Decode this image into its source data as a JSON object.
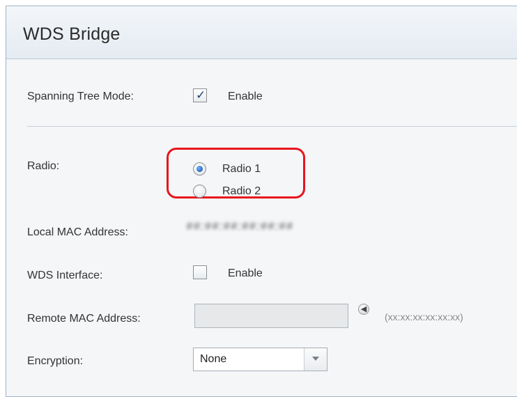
{
  "page_title": "WDS Bridge",
  "spanning_tree": {
    "label": "Spanning Tree Mode:",
    "option_label": "Enable",
    "checked": true
  },
  "radio": {
    "label": "Radio:",
    "options": [
      {
        "label": "Radio 1",
        "selected": true
      },
      {
        "label": "Radio 2",
        "selected": false
      }
    ],
    "highlight_color": "#e8141c"
  },
  "local_mac": {
    "label": "Local MAC Address:",
    "value": "##:##:##:##:##:##"
  },
  "wds_interface": {
    "label": "WDS Interface:",
    "option_label": "Enable",
    "checked": false
  },
  "remote_mac": {
    "label": "Remote MAC Address:",
    "value": "",
    "hint": "(xx:xx:xx:xx:xx:xx)",
    "go_icon": "arrow-left-icon"
  },
  "encryption": {
    "label": "Encryption:",
    "selected": "None"
  },
  "colors": {
    "accent": "#1d3c78",
    "highlight": "#e8141c"
  }
}
